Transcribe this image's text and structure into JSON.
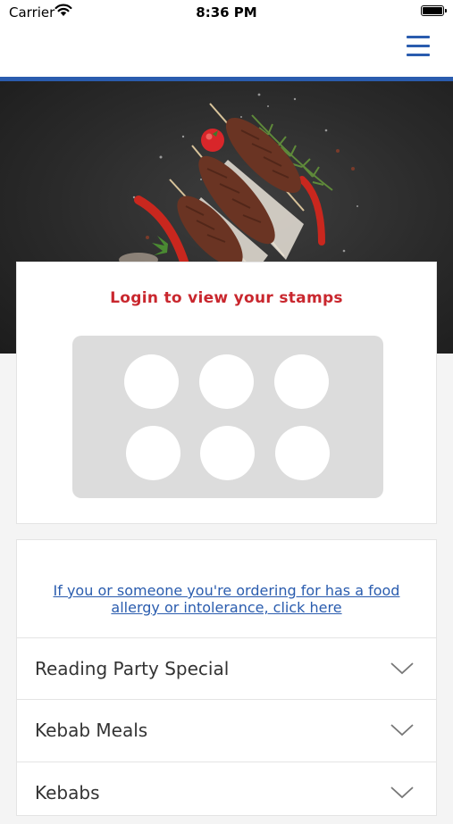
{
  "status_bar": {
    "carrier": "Carrier",
    "time": "8:36 PM"
  },
  "header": {
    "menu_icon": "hamburger-menu-icon"
  },
  "loyalty": {
    "title": "Login to view your stamps",
    "stamp_count": 6
  },
  "allergy_notice": {
    "link_text": "If you or someone you're ordering for has a food allergy or intolerance, click here"
  },
  "menu_categories": [
    {
      "label": "Reading Party Special"
    },
    {
      "label": "Kebab Meals"
    },
    {
      "label": "Kebabs"
    }
  ],
  "colors": {
    "accent_blue": "#2a5cae",
    "accent_red": "#c9272e",
    "stamp_panel": "#dcdcdc"
  }
}
